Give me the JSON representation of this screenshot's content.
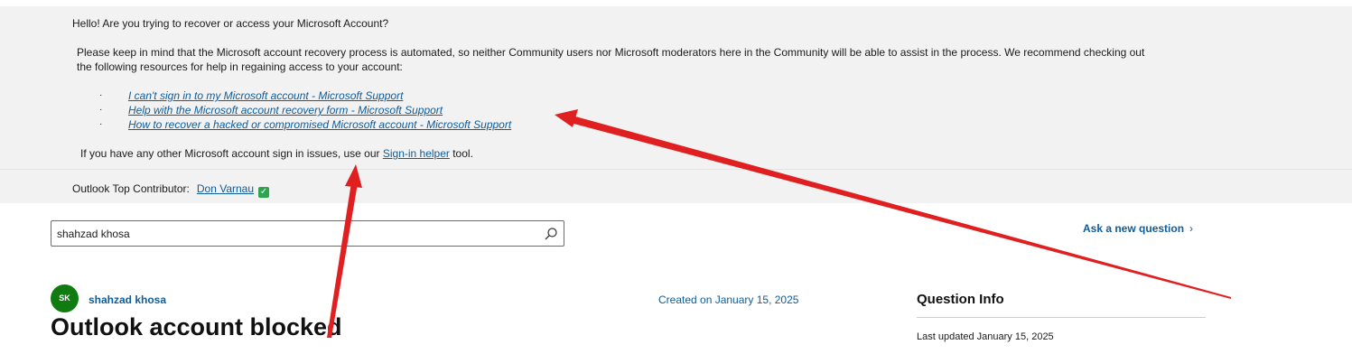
{
  "banner": {
    "greeting": "Hello! Are you trying to recover or access your Microsoft Account?",
    "note_line1": "Please keep in mind that the Microsoft account recovery process is automated, so neither Community users nor Microsoft moderators here in the Community will be able to assist in the process. We recommend checking out",
    "note_line2": "the following resources for help in regaining access to your account:",
    "bullet_glyph": "·",
    "links": [
      "I can't sign in to my Microsoft account - Microsoft Support",
      "Help with the Microsoft account recovery form - Microsoft Support",
      "How to recover a hacked or compromised Microsoft account - Microsoft Support"
    ],
    "other_prefix": "If you have any other Microsoft account sign in issues, use our ",
    "other_link": "Sign-in helper",
    "other_suffix": " tool."
  },
  "contributor": {
    "label": "Outlook Top Contributor:",
    "name": "Don Varnau",
    "badge_glyph": "✓"
  },
  "search": {
    "value": "shahzad khosa"
  },
  "ask_question": {
    "label": "Ask a new question",
    "chevron": "›"
  },
  "post": {
    "avatar_initials": "SK",
    "author": "shahzad khosa",
    "title": "Outlook account blocked",
    "created": "Created on January 15, 2025"
  },
  "question_info": {
    "heading": "Question Info",
    "last_updated": "Last updated January 15, 2025"
  },
  "colors": {
    "banner_bg": "#f2f2f2",
    "link": "#0f5c99",
    "avatar": "#107c10",
    "annotation_arrow": "#e02020",
    "badge": "#2ea44f"
  }
}
